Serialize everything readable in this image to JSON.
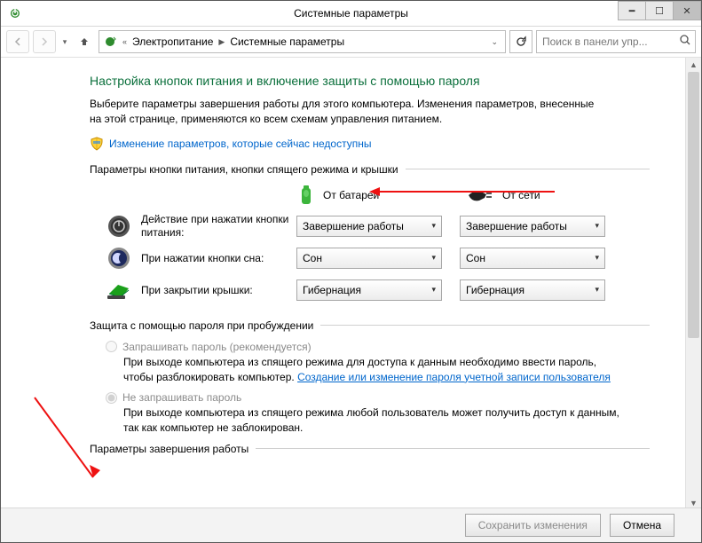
{
  "window": {
    "title": "Системные параметры"
  },
  "nav": {
    "breadcrumb": [
      "Электропитание",
      "Системные параметры"
    ],
    "search_placeholder": "Поиск в панели упр..."
  },
  "page": {
    "heading": "Настройка кнопок питания и включение защиты с помощью пароля",
    "description": "Выберите параметры завершения работы для этого компьютера. Изменения параметров, внесенные на этой странице, применяются ко всем схемам управления питанием.",
    "change_link": "Изменение параметров, которые сейчас недоступны"
  },
  "sections": {
    "buttons_header": "Параметры кнопки питания, кнопки спящего режима и крышки",
    "battery_label": "От батареи",
    "ac_label": "От сети",
    "rows": {
      "power": {
        "label": "Действие при нажатии кнопки питания:",
        "battery": "Завершение работы",
        "ac": "Завершение работы"
      },
      "sleep": {
        "label": "При нажатии кнопки сна:",
        "battery": "Сон",
        "ac": "Сон"
      },
      "lid": {
        "label": "При закрытии крышки:",
        "battery": "Гибернация",
        "ac": "Гибернация"
      }
    },
    "password_header": "Защита с помощью пароля при пробуждении",
    "pw_require_label": "Запрашивать пароль (рекомендуется)",
    "pw_require_desc_a": "При выходе компьютера из спящего режима для доступа к данным необходимо ввести пароль, чтобы разблокировать компьютер. ",
    "pw_require_link": "Создание или изменение пароля учетной записи пользователя",
    "pw_no_label": "Не запрашивать пароль",
    "pw_no_desc": "При выходе компьютера из спящего режима любой пользователь может получить доступ к данным, так как компьютер не заблокирован.",
    "shutdown_header": "Параметры завершения работы"
  },
  "footer": {
    "save": "Сохранить изменения",
    "cancel": "Отмена"
  }
}
